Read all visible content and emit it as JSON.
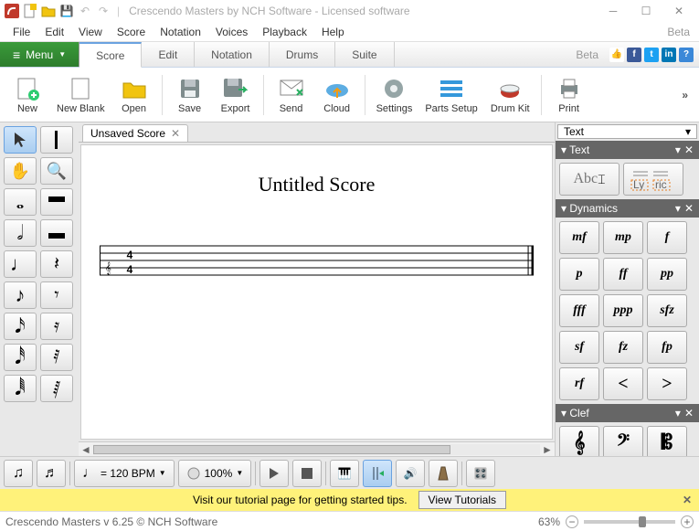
{
  "title": "Crescendo Masters by NCH Software - Licensed software",
  "menubar": [
    "File",
    "Edit",
    "View",
    "Score",
    "Notation",
    "Voices",
    "Playback",
    "Help"
  ],
  "menubar_beta": "Beta",
  "menu_button": "Menu",
  "tabs": [
    "Score",
    "Edit",
    "Notation",
    "Drums",
    "Suite"
  ],
  "tabs_beta": "Beta",
  "ribbon": {
    "new": "New",
    "newblank": "New Blank",
    "open": "Open",
    "save": "Save",
    "export": "Export",
    "send": "Send",
    "cloud": "Cloud",
    "settings": "Settings",
    "parts": "Parts Setup",
    "drumkit": "Drum Kit",
    "print": "Print"
  },
  "doc_tab": "Unsaved Score",
  "score_title": "Untitled Score",
  "right": {
    "dropdown": "Text",
    "sec_text": "Text",
    "sec_dyn": "Dynamics",
    "sec_clef": "Clef",
    "txt_abc": "Abc",
    "txt_lyric": "Ly ric",
    "dyn": [
      "mf",
      "mp",
      "f",
      "p",
      "ff",
      "pp",
      "fff",
      "ppp",
      "sfz",
      "sf",
      "fz",
      "fp",
      "rf",
      "<",
      ">"
    ]
  },
  "bpm_label": "= 120 BPM",
  "zoom_label": "100%",
  "tutorial_text": "Visit our tutorial page for getting started tips.",
  "tutorial_btn": "View Tutorials",
  "status": "Crescendo Masters v 6.25 © NCH Software",
  "status_zoom": "63%"
}
